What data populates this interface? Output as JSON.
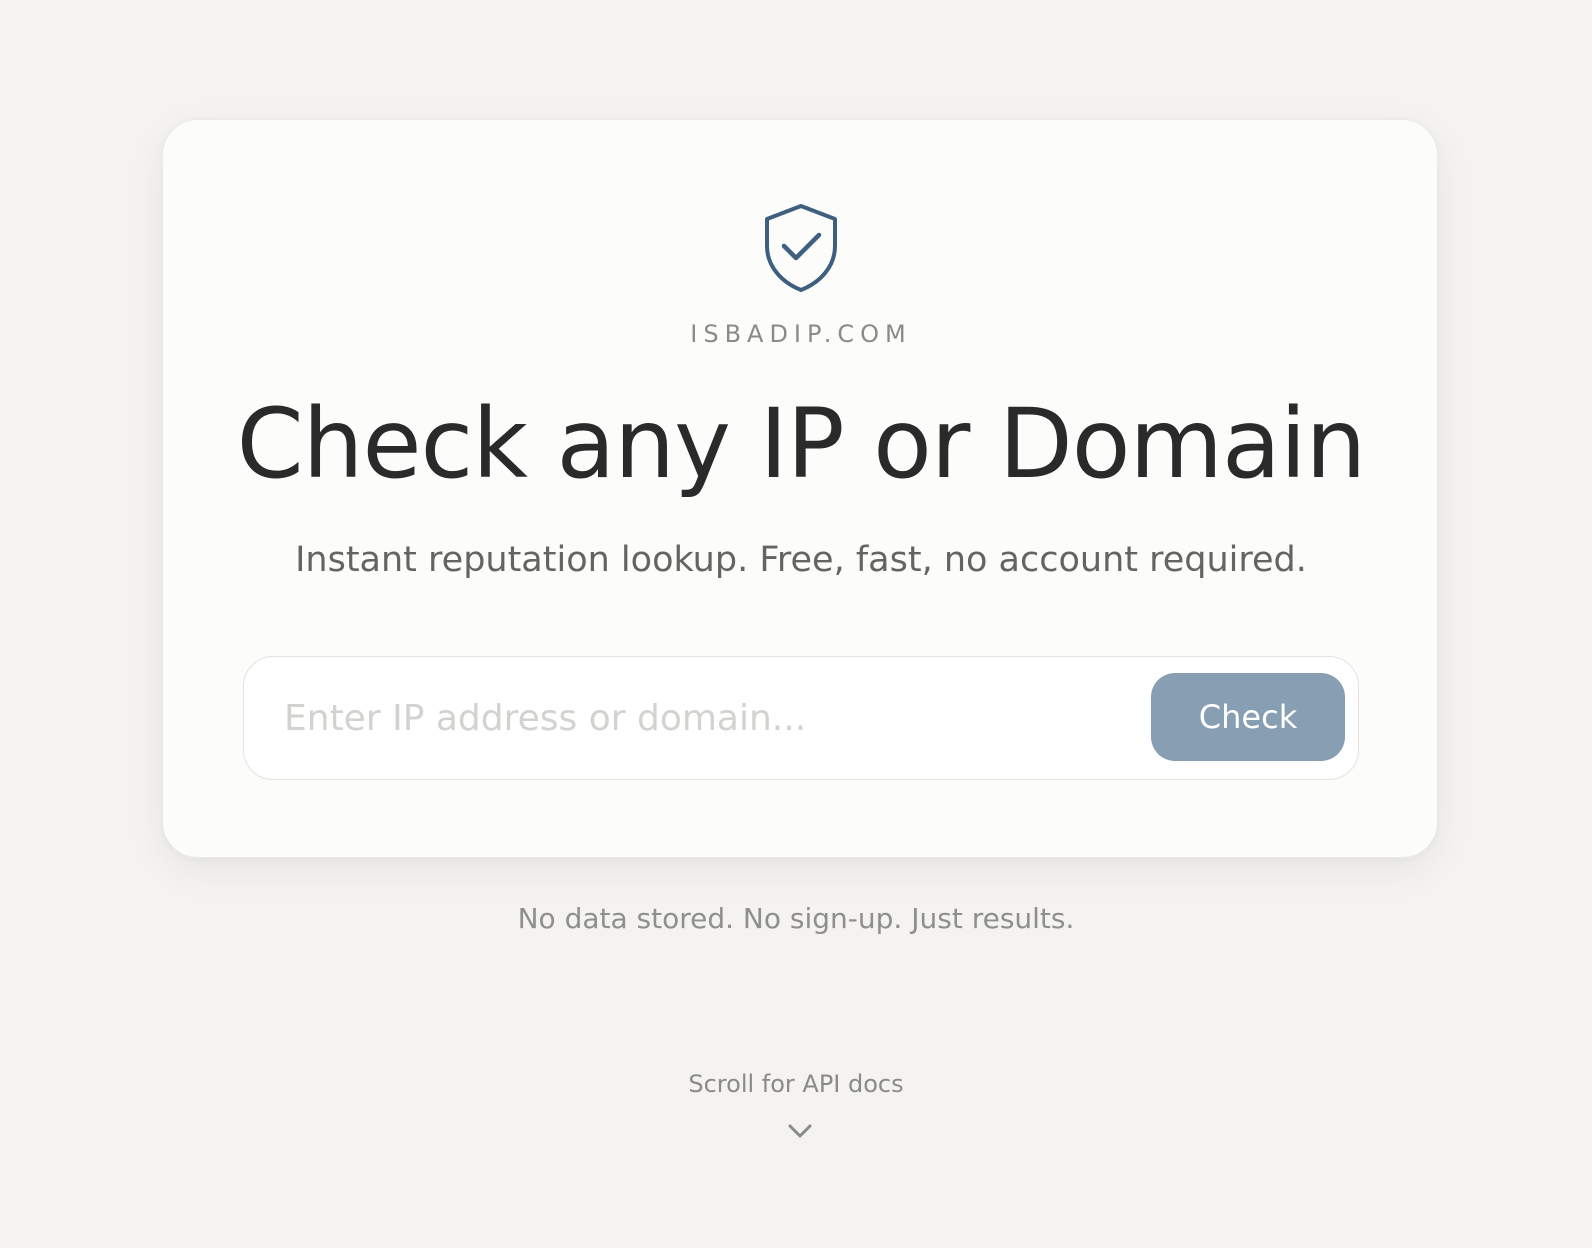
{
  "brand": {
    "name": "ISBADIP.COM",
    "icon": "shield-check-icon",
    "icon_color": "#3f5f80"
  },
  "hero": {
    "title": "Check any IP or Domain",
    "subtitle": "Instant reputation lookup. Free, fast, no account required."
  },
  "search": {
    "placeholder": "Enter IP address or domain...",
    "value": "",
    "button_label": "Check",
    "button_color": "#889eb3"
  },
  "footer": {
    "tagline": "No data stored. No sign-up. Just results.",
    "scroll_hint": "Scroll for API docs",
    "scroll_icon": "chevron-down-icon"
  }
}
